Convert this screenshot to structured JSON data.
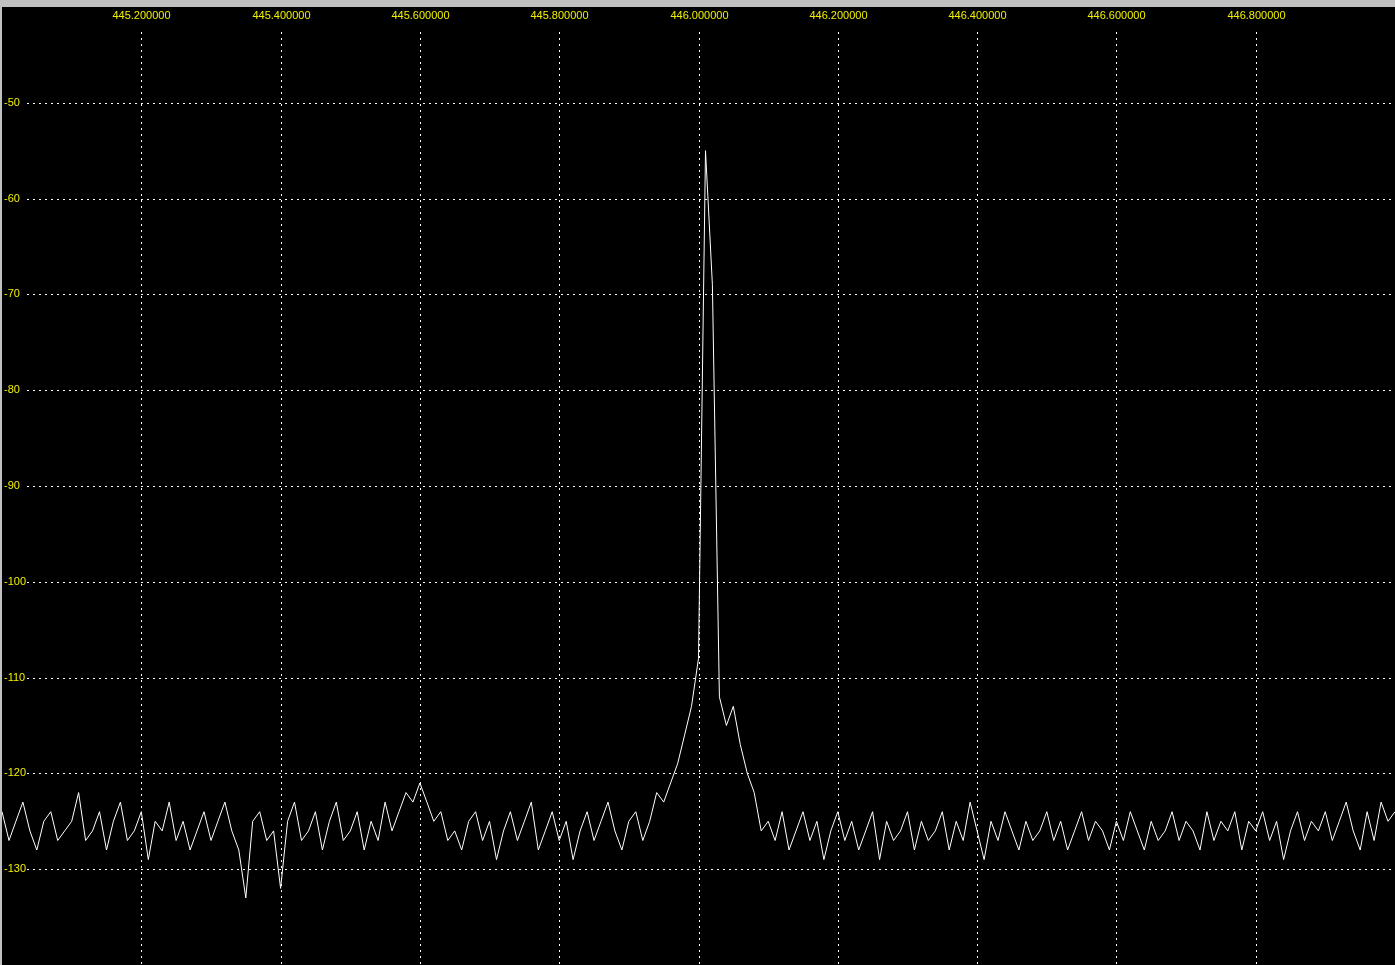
{
  "spectrum": {
    "chart_data": {
      "type": "line",
      "grid": true,
      "xlim": [
        445.0,
        447.0
      ],
      "ylim": [
        -140,
        -40
      ],
      "xticks": [
        {
          "value": 445.2,
          "label": "445.200000"
        },
        {
          "value": 445.4,
          "label": "445.400000"
        },
        {
          "value": 445.6,
          "label": "445.600000"
        },
        {
          "value": 445.8,
          "label": "445.800000"
        },
        {
          "value": 446.0,
          "label": "446.000000"
        },
        {
          "value": 446.2,
          "label": "446.200000"
        },
        {
          "value": 446.4,
          "label": "446.400000"
        },
        {
          "value": 446.6,
          "label": "446.600000"
        },
        {
          "value": 446.8,
          "label": "446.800000"
        }
      ],
      "yticks": [
        {
          "value": -50,
          "label": "-50"
        },
        {
          "value": -60,
          "label": "-60"
        },
        {
          "value": -70,
          "label": "-70"
        },
        {
          "value": -80,
          "label": "-80"
        },
        {
          "value": -90,
          "label": "-90"
        },
        {
          "value": -100,
          "label": "-100"
        },
        {
          "value": -110,
          "label": "-110"
        },
        {
          "value": -120,
          "label": "-120"
        },
        {
          "value": -130,
          "label": "-130"
        }
      ],
      "x": [
        445.0,
        445.01,
        445.02,
        445.03,
        445.04,
        445.05,
        445.06,
        445.07,
        445.08,
        445.09,
        445.1,
        445.11,
        445.12,
        445.13,
        445.14,
        445.15,
        445.16,
        445.17,
        445.18,
        445.19,
        445.2,
        445.21,
        445.22,
        445.23,
        445.24,
        445.25,
        445.26,
        445.27,
        445.28,
        445.29,
        445.3,
        445.31,
        445.32,
        445.33,
        445.34,
        445.35,
        445.36,
        445.37,
        445.38,
        445.39,
        445.4,
        445.41,
        445.42,
        445.43,
        445.44,
        445.45,
        445.46,
        445.47,
        445.48,
        445.49,
        445.5,
        445.51,
        445.52,
        445.53,
        445.54,
        445.55,
        445.56,
        445.57,
        445.58,
        445.59,
        445.6,
        445.61,
        445.62,
        445.63,
        445.64,
        445.65,
        445.66,
        445.67,
        445.68,
        445.69,
        445.7,
        445.71,
        445.72,
        445.73,
        445.74,
        445.75,
        445.76,
        445.77,
        445.78,
        445.79,
        445.8,
        445.81,
        445.82,
        445.83,
        445.84,
        445.85,
        445.86,
        445.87,
        445.88,
        445.89,
        445.9,
        445.91,
        445.92,
        445.93,
        445.94,
        445.95,
        445.96,
        445.97,
        445.98,
        445.99,
        446.0,
        446.01,
        446.02,
        446.03,
        446.04,
        446.05,
        446.06,
        446.07,
        446.08,
        446.09,
        446.1,
        446.11,
        446.12,
        446.13,
        446.14,
        446.15,
        446.16,
        446.17,
        446.18,
        446.19,
        446.2,
        446.21,
        446.22,
        446.23,
        446.24,
        446.25,
        446.26,
        446.27,
        446.28,
        446.29,
        446.3,
        446.31,
        446.32,
        446.33,
        446.34,
        446.35,
        446.36,
        446.37,
        446.38,
        446.39,
        446.4,
        446.41,
        446.42,
        446.43,
        446.44,
        446.45,
        446.46,
        446.47,
        446.48,
        446.49,
        446.5,
        446.51,
        446.52,
        446.53,
        446.54,
        446.55,
        446.56,
        446.57,
        446.58,
        446.59,
        446.6,
        446.61,
        446.62,
        446.63,
        446.64,
        446.65,
        446.66,
        446.67,
        446.68,
        446.69,
        446.7,
        446.71,
        446.72,
        446.73,
        446.74,
        446.75,
        446.76,
        446.77,
        446.78,
        446.79,
        446.8,
        446.81,
        446.82,
        446.83,
        446.84,
        446.85,
        446.86,
        446.87,
        446.88,
        446.89,
        446.9,
        446.91,
        446.92,
        446.93,
        446.94,
        446.95,
        446.96,
        446.97,
        446.98,
        446.99,
        447.0
      ],
      "series": [
        {
          "color": "#ffffff",
          "values": [
            -124,
            -127,
            -125,
            -123,
            -126,
            -128,
            -125,
            -124,
            -127,
            -126,
            -125,
            -122,
            -127,
            -126,
            -124,
            -128,
            -125,
            -123,
            -127,
            -126,
            -124,
            -129,
            -125,
            -126,
            -123,
            -127,
            -125,
            -128,
            -126,
            -124,
            -127,
            -125,
            -123,
            -126,
            -128,
            -133,
            -125,
            -124,
            -127,
            -126,
            -132,
            -125,
            -123,
            -127,
            -126,
            -124,
            -128,
            -125,
            -123,
            -127,
            -126,
            -124,
            -128,
            -125,
            -127,
            -123,
            -126,
            -124,
            -122,
            -123,
            -121,
            -123,
            -125,
            -124,
            -127,
            -126,
            -128,
            -125,
            -124,
            -127,
            -125,
            -129,
            -126,
            -124,
            -127,
            -125,
            -123,
            -128,
            -126,
            -124,
            -127,
            -125,
            -129,
            -126,
            -124,
            -127,
            -125,
            -123,
            -126,
            -128,
            -125,
            -124,
            -127,
            -125,
            -122,
            -123,
            -121,
            -119,
            -116,
            -113,
            -108,
            -55,
            -69,
            -112,
            -115,
            -113,
            -117,
            -120,
            -122,
            -126,
            -125,
            -127,
            -124,
            -128,
            -126,
            -124,
            -127,
            -125,
            -129,
            -126,
            -124,
            -127,
            -125,
            -128,
            -126,
            -124,
            -129,
            -125,
            -127,
            -126,
            -124,
            -128,
            -125,
            -127,
            -126,
            -124,
            -128,
            -125,
            -127,
            -123,
            -126,
            -129,
            -125,
            -127,
            -124,
            -126,
            -128,
            -125,
            -127,
            -126,
            -124,
            -127,
            -125,
            -128,
            -126,
            -124,
            -127,
            -125,
            -126,
            -128,
            -125,
            -127,
            -124,
            -126,
            -128,
            -125,
            -127,
            -126,
            -124,
            -127,
            -125,
            -126,
            -128,
            -124,
            -127,
            -125,
            -126,
            -124,
            -128,
            -125,
            -126,
            -124,
            -127,
            -125,
            -129,
            -126,
            -124,
            -127,
            -125,
            -126,
            -124,
            -127,
            -125,
            -123,
            -126,
            -128,
            -124,
            -127,
            -123,
            -125,
            -124
          ]
        }
      ]
    }
  }
}
